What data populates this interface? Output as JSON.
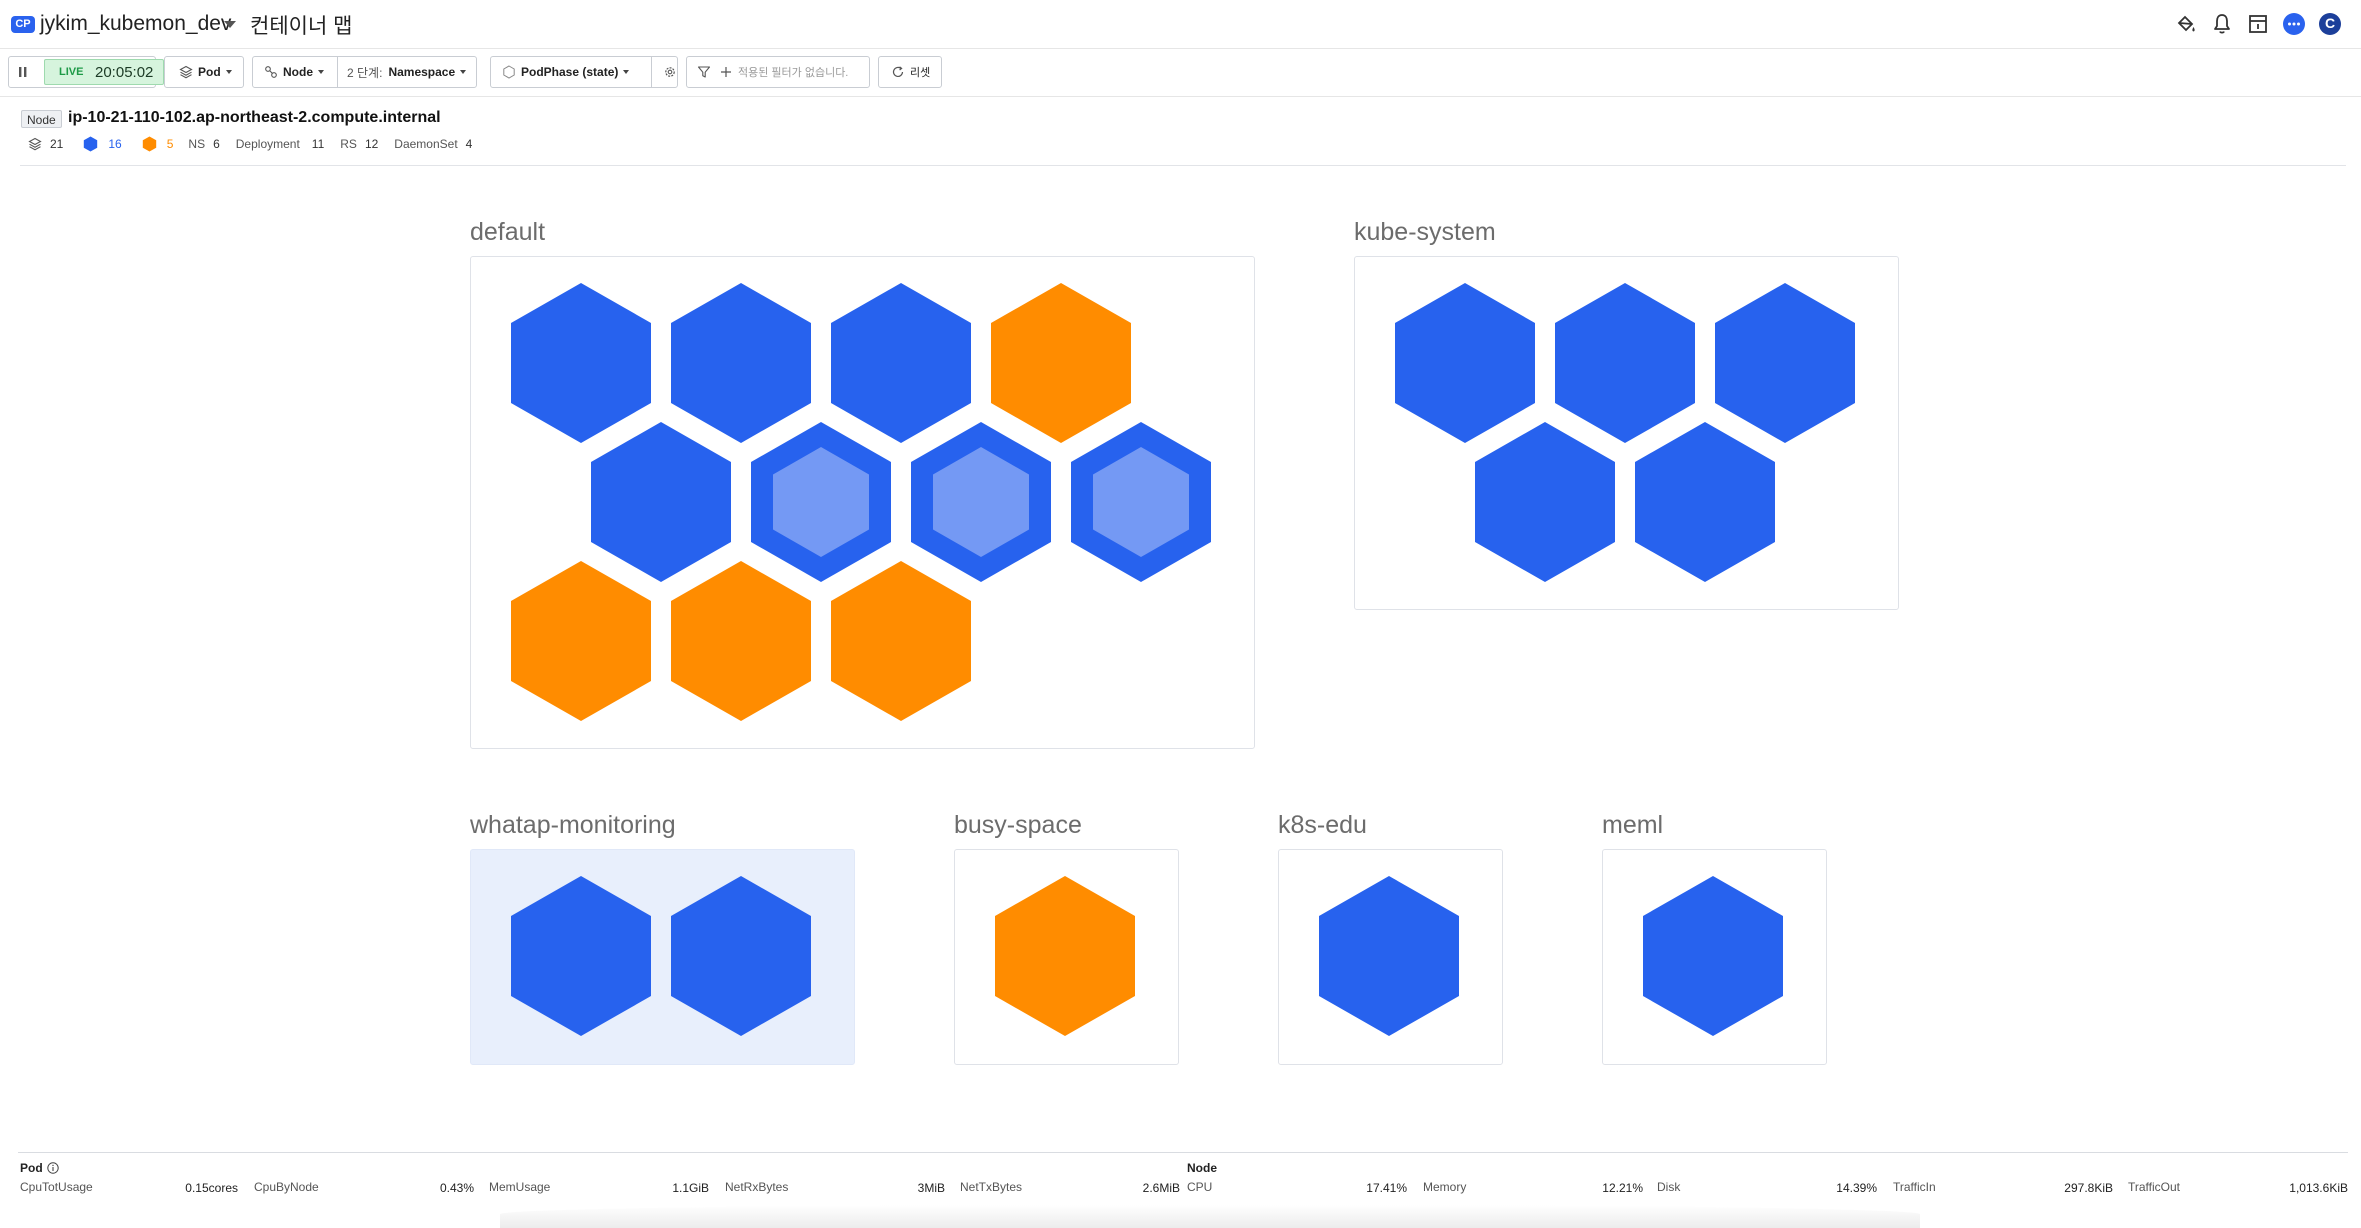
{
  "header": {
    "badge": "CP",
    "project_name": "jykim_kubemon_dev",
    "page_title": "컨테이너 맵",
    "icons": [
      "paint-bucket-icon",
      "bell-icon",
      "calendar-icon",
      "chat-icon"
    ],
    "avatar_letter": "C"
  },
  "toolbar": {
    "live_label": "LIVE",
    "time": "20:05:02",
    "pod_label": "Pod",
    "node_label": "Node",
    "level_prefix": "2 단계:",
    "level_value": "Namespace",
    "phase_label": "PodPhase (state)",
    "filter_placeholder": "적용된 필터가 없습니다.",
    "reset_label": "리셋"
  },
  "node": {
    "tag": "Node",
    "name": "ip-10-21-110-102.ap-northeast-2.compute.internal",
    "stats": {
      "total": "21",
      "running": "16",
      "pending": "5",
      "ns_label": "NS",
      "ns": "6",
      "deployment_label": "Deployment",
      "deployment": "11",
      "rs_label": "RS",
      "rs": "12",
      "daemonset_label": "DaemonSet",
      "daemonset": "4"
    }
  },
  "colors": {
    "running": "#2762ee",
    "pending": "#ff8c00",
    "inner": "#7499f4",
    "selected_bg": "#e8effc"
  },
  "namespaces": [
    {
      "name": "default",
      "pods": [
        "running",
        "running",
        "running",
        "pending",
        "running",
        "running-inner",
        "running-inner",
        "running-inner",
        "pending",
        "pending",
        "pending"
      ]
    },
    {
      "name": "kube-system",
      "pods": [
        "running",
        "running",
        "running",
        "running",
        "running"
      ]
    },
    {
      "name": "whatap-monitoring",
      "selected": true,
      "pods": [
        "running",
        "running"
      ]
    },
    {
      "name": "busy-space",
      "pods": [
        "pending"
      ]
    },
    {
      "name": "k8s-edu",
      "pods": [
        "running"
      ]
    },
    {
      "name": "meml",
      "pods": [
        "running"
      ]
    }
  ],
  "metrics": {
    "pod_title": "Pod",
    "node_title": "Node",
    "pod": [
      {
        "label": "CpuTotUsage",
        "value": "0.15cores"
      },
      {
        "label": "CpuByNode",
        "value": "0.43%"
      },
      {
        "label": "MemUsage",
        "value": "1.1GiB"
      },
      {
        "label": "NetRxBytes",
        "value": "3MiB"
      },
      {
        "label": "NetTxBytes",
        "value": "2.6MiB"
      }
    ],
    "node": [
      {
        "label": "CPU",
        "value": "17.41%"
      },
      {
        "label": "Memory",
        "value": "12.21%"
      },
      {
        "label": "Disk",
        "value": "14.39%"
      },
      {
        "label": "TrafficIn",
        "value": "297.8KiB"
      },
      {
        "label": "TrafficOut",
        "value": "1,013.6KiB"
      }
    ]
  }
}
